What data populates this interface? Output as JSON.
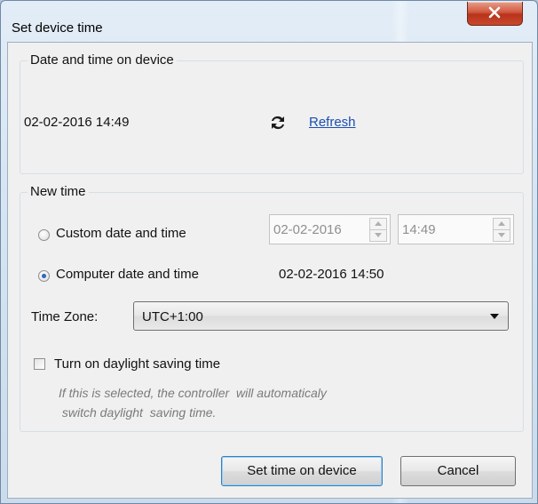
{
  "window": {
    "title": "Set device time",
    "close_icon": "close-icon"
  },
  "device_group": {
    "label": "Date and time on device",
    "current_datetime": "02-02-2016 14:49",
    "refresh_icon": "refresh-icon",
    "refresh_label": "Refresh"
  },
  "new_time_group": {
    "label": "New time",
    "custom": {
      "label": "Custom date and  time",
      "selected": false,
      "date_value": "02-02-2016",
      "time_value": "14:49"
    },
    "computer": {
      "label": "Computer date and time",
      "selected": true,
      "datetime": "02-02-2016 14:50"
    },
    "timezone": {
      "label": "Time Zone:",
      "value": "UTC+1:00"
    },
    "dst": {
      "label": "Turn on daylight saving time",
      "checked": false,
      "hint_line1": "If this is selected, the controller  will automaticaly",
      "hint_line2": " switch daylight  saving time."
    }
  },
  "buttons": {
    "set_label": "Set time on device",
    "cancel_label": "Cancel"
  },
  "colors": {
    "link": "#1b4fb3",
    "close_button": "#c9472c",
    "disabled_text": "#8f8f8f"
  }
}
